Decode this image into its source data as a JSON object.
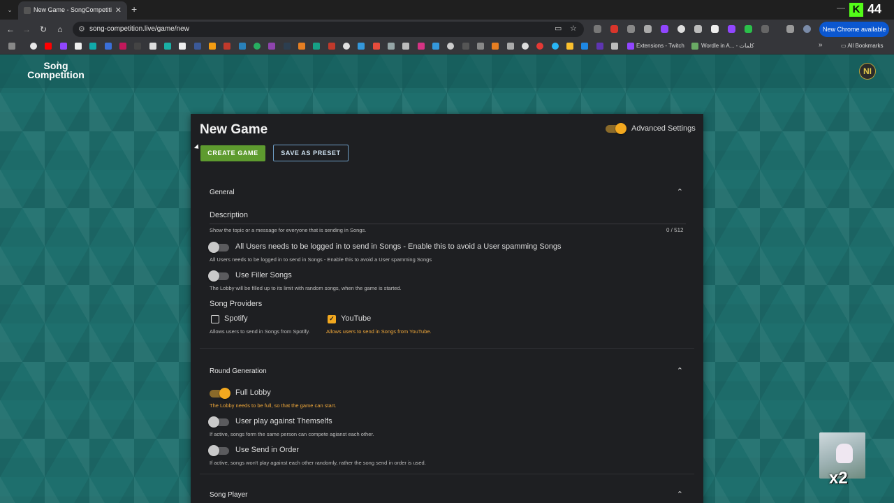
{
  "browser": {
    "tab_title": "New Game - SongCompetition",
    "tab_close": "✕",
    "new_tab": "+",
    "url": "song-competition.live/game/new",
    "new_chrome_label": "New Chrome available",
    "bookmarks": [
      {
        "label": "Extensions - Twitch",
        "icon": "extension-icon",
        "color": "#9146ff"
      },
      {
        "label": "Wordle in A... - كلمات",
        "icon": "wordle-icon",
        "color": "#6aaa64"
      }
    ],
    "all_bookmarks_label": "All Bookmarks",
    "kick_count": "44"
  },
  "app": {
    "logo_line1": "Song",
    "logo_line2": "Competition",
    "avatar_initials": "NI"
  },
  "form": {
    "title": "New Game",
    "create_button": "CREATE GAME",
    "preset_button": "SAVE AS PRESET",
    "advanced_settings_label": "Advanced Settings",
    "advanced_settings_on": true,
    "general": {
      "title": "General",
      "description_label": "Description",
      "description_hint": "Show the topic or a message for everyone that is sending in Songs.",
      "description_counter": "0 / 512",
      "login_toggle_label": "All Users needs to be logged in to send in Songs - Enable this to avoid a User spamming Songs",
      "login_toggle_hint": "All Users needs to be logged in to send in Songs - Enable this to avoid a User spamming Songs",
      "filler_toggle_label": "Use Filler Songs",
      "filler_toggle_hint": "The Lobby will be filled up to its limit with random songs, when the game is started.",
      "providers_label": "Song Providers",
      "spotify_label": "Spotify",
      "spotify_hint": "Allows users to send in Songs from Spotify.",
      "spotify_checked": false,
      "youtube_label": "YouTube",
      "youtube_hint": "Allows users to send in Songs from YouTube.",
      "youtube_checked": true
    },
    "round_generation": {
      "title": "Round Generation",
      "full_lobby_label": "Full Lobby",
      "full_lobby_hint": "The Lobby needs to be full, so that the game can start.",
      "full_lobby_on": true,
      "self_play_label": "User play against Themselfs",
      "self_play_hint": "If active, songs form the same person can compete agianst each other.",
      "send_order_label": "Use Send in Order",
      "send_order_hint": "If active, songs won't play against each other randomly, rather the song send in order is used."
    },
    "song_player": {
      "title": "Song Player"
    }
  },
  "overlay": {
    "multiplier": "x2"
  },
  "colors": {
    "accent": "#f2a81f",
    "create_button": "#5e9b2f",
    "background": "#1e6f6d",
    "card": "#1e1f22"
  }
}
